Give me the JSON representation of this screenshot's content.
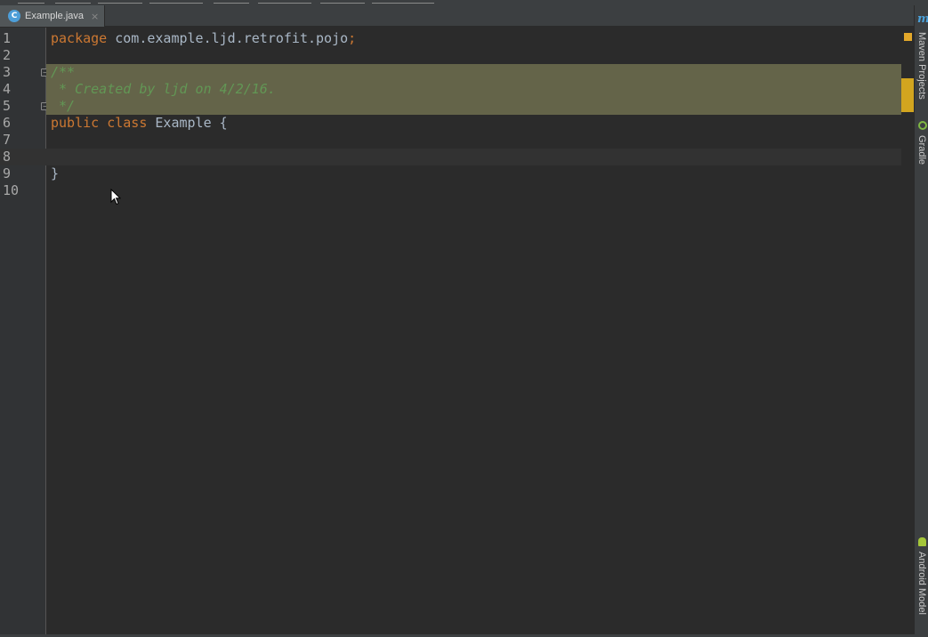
{
  "tabs": [
    {
      "label": "Example.java",
      "icon": "class-icon",
      "icon_letter": "C",
      "close_glyph": "×"
    }
  ],
  "code": {
    "lines": [
      {
        "number": "1",
        "segments": [
          {
            "text": "package",
            "style": "kw"
          },
          {
            "text": " com.example.ljd.retrofit.pojo",
            "style": ""
          },
          {
            "text": ";",
            "style": "kw"
          }
        ]
      },
      {
        "number": "2",
        "segments": []
      },
      {
        "number": "3",
        "segments": [
          {
            "text": "/**",
            "style": "cm"
          }
        ],
        "fold": "−",
        "comment_bg": true
      },
      {
        "number": "4",
        "segments": [
          {
            "text": " * Created by ljd on 4/2/16.",
            "style": "cm"
          }
        ],
        "comment_bg": true
      },
      {
        "number": "5",
        "segments": [
          {
            "text": " */",
            "style": "cm"
          }
        ],
        "fold": "−",
        "comment_bg": true
      },
      {
        "number": "6",
        "segments": [
          {
            "text": "public",
            "style": "kw"
          },
          {
            "text": " ",
            "style": ""
          },
          {
            "text": "class",
            "style": "kw"
          },
          {
            "text": " Example {",
            "style": ""
          }
        ]
      },
      {
        "number": "7",
        "segments": []
      },
      {
        "number": "8",
        "segments": [],
        "caret_row": true
      },
      {
        "number": "9",
        "segments": [
          {
            "text": "}",
            "style": ""
          }
        ]
      },
      {
        "number": "10",
        "segments": []
      }
    ]
  },
  "tool_windows": {
    "maven_icon": "m",
    "maven": "Maven Projects",
    "gradle": "Gradle",
    "android_model": "Android Model"
  },
  "colors": {
    "editor_bg": "#2b2b2b",
    "keyword": "#cc7832",
    "comment": "#629755",
    "comment_highlight": "#646449",
    "warning_stripe": "#d2a51f"
  }
}
